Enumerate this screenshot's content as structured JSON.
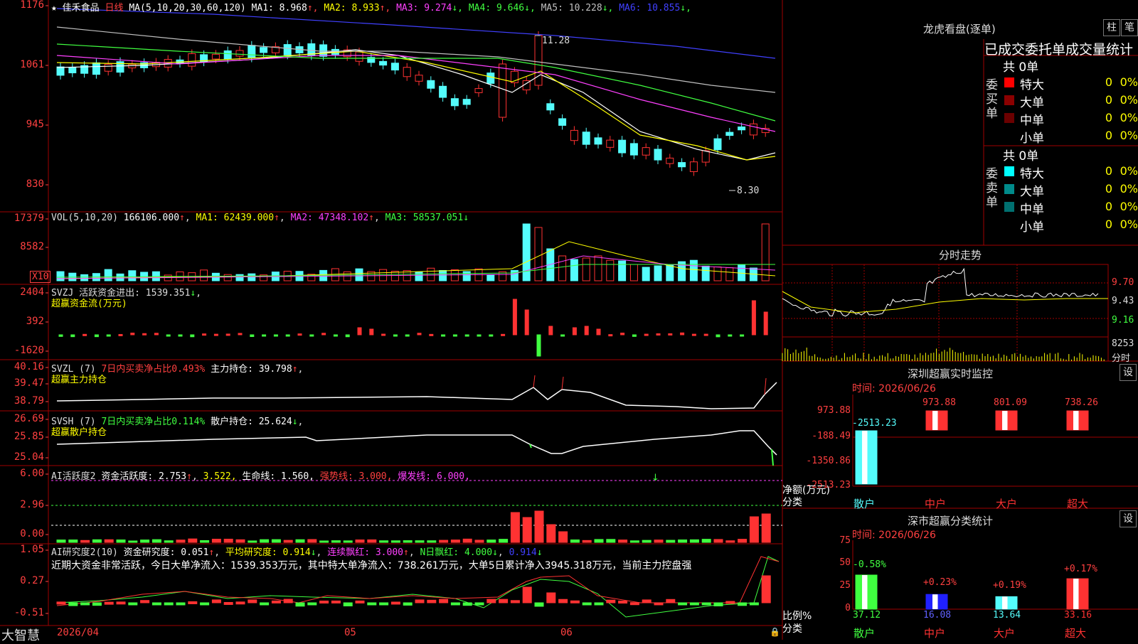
{
  "main_chart": {
    "star": "★",
    "stock_name": "佳禾食品",
    "period": "日线",
    "ma_title": "MA(5,10,20,30,60,120)",
    "ma_values": [
      {
        "label": "MA1: 8.968",
        "arrow": "↑",
        "color": "#ffffff"
      },
      {
        "label": "MA2: 8.933",
        "arrow": "↑",
        "color": "#ffff00"
      },
      {
        "label": "MA3: 9.274",
        "arrow": "↓",
        "color": "#ff40ff"
      },
      {
        "label": "MA4: 9.646",
        "arrow": "↓",
        "color": "#40ff40"
      },
      {
        "label": "MA5: 10.228",
        "arrow": "↓",
        "color": "#c0c0c0"
      },
      {
        "label": "MA6: 10.855",
        "arrow": "↓",
        "color": "#4040ff"
      }
    ],
    "y_ticks": [
      "1176",
      "1061",
      "945",
      "830"
    ],
    "high_label": "11.28",
    "low_label": "8.30"
  },
  "vol_panel": {
    "title": "VOL(5,10,20)",
    "value": "166106.000",
    "ma1": "MA1: 62439.000",
    "ma2": "MA2: 47348.102",
    "ma3": "MA3: 58537.051",
    "y_ticks": [
      "17379",
      "8582"
    ],
    "unit": "X10"
  },
  "svzj_panel": {
    "title": "SVZJ",
    "line1": "活跃资金进出: 1539.351",
    "line2": "超赢资金流(万元)",
    "y_ticks": [
      "2404",
      "392",
      "-1620"
    ]
  },
  "svzl_panel": {
    "title": "SVZL (7)",
    "ratio": "7日内买卖净占比0.493%",
    "holding": "主力持仓: 39.798",
    "line2": "超赢主力持仓",
    "y_ticks": [
      "40.16",
      "39.47",
      "38.79"
    ]
  },
  "svsh_panel": {
    "title": "SVSH (7)",
    "ratio": "7日内买卖净占比0.114%",
    "holding": "散户持仓: 25.624",
    "line2": "超赢散户持仓",
    "y_ticks": [
      "26.69",
      "25.85",
      "25.04"
    ]
  },
  "ai_active_panel": {
    "title": "AI活跃度2",
    "a": "资金活跃度: 2.753",
    "b": "3.522,",
    "c": "生命线: 1.560,",
    "d": "强势线: 3.000,",
    "e": "爆发线: 6.000,",
    "y_ticks": [
      "6.00",
      "2.96",
      "0.00"
    ]
  },
  "ai_research_panel": {
    "title": "AI研究度2(10)",
    "a": "资金研究度: 0.051",
    "b": "平均研究度: 0.914",
    "c": "连续飘红: 3.000",
    "d": "N日飘红: 4.000",
    "e": "0.914",
    "summary": "近期大资金非常活跃，今日大单净流入：1539.353万元，其中特大单净流入：738.261万元，大单5日累计净入3945.318万元，当前主力控盘强",
    "y_ticks": [
      "1.05",
      "0.27",
      "-0.51"
    ]
  },
  "bottom_bar": {
    "brand": "大智慧",
    "date": "2026/04",
    "m5": "05",
    "m6": "06"
  },
  "dragon_tiger": {
    "title": "龙虎看盘(逐单)",
    "btn_a": "柱",
    "btn_b": "笔",
    "col_header": "已成交委托单成交量统计",
    "buy_label": "委买单",
    "sell_label": "委卖单",
    "buy_total": "共 0单",
    "sell_total": "共 0单",
    "buy_rows": [
      {
        "name": "特大",
        "count": "0",
        "pct": "0%",
        "color": "#ff0000"
      },
      {
        "name": "大单",
        "count": "0",
        "pct": "0%",
        "color": "#8b0000"
      },
      {
        "name": "中单",
        "count": "0",
        "pct": "0%",
        "color": "#6b0000"
      },
      {
        "name": "小单",
        "count": "0",
        "pct": "0%",
        "color": "#000000"
      }
    ],
    "sell_rows": [
      {
        "name": "特大",
        "count": "0",
        "pct": "0%",
        "color": "#00ffff"
      },
      {
        "name": "大单",
        "count": "0",
        "pct": "0%",
        "color": "#008b8b"
      },
      {
        "name": "中单",
        "count": "0",
        "pct": "0%",
        "color": "#007070"
      },
      {
        "name": "小单",
        "count": "0",
        "pct": "0%",
        "color": "#000000"
      }
    ]
  },
  "intraday": {
    "title": "分时走势",
    "p_high": "9.70",
    "p_mid": "9.43",
    "p_low": "9.16",
    "vol": "8253",
    "vol_unit": "分时"
  },
  "sz_monitor": {
    "title": "深圳超赢实时监控",
    "setting": "设",
    "time": "时间: 2026/06/26",
    "y_ticks": [
      "973.88",
      "-188.49",
      "-1350.86",
      "-2513.23"
    ],
    "left_value": "-2513.23",
    "bar_values": [
      "973.88",
      "801.09",
      "738.26"
    ],
    "unit_label": "净额(万元)",
    "cat_label": "分类",
    "categories": [
      "散户",
      "中户",
      "大户",
      "超大"
    ],
    "chart_data": {
      "type": "bar",
      "categories": [
        "散户",
        "中户",
        "大户",
        "超大"
      ],
      "values": [
        -2513.23,
        973.88,
        801.09,
        738.26
      ],
      "ylabel": "净额(万元)",
      "xlabel": "分类"
    }
  },
  "sz_stats": {
    "title": "深市超赢分类统计",
    "setting": "设",
    "time": "时间: 2026/06/26",
    "y_ticks": [
      "75",
      "50",
      "25",
      "0"
    ],
    "changes": [
      "-0.58%",
      "+0.23%",
      "+0.19%",
      "+0.17%"
    ],
    "values": [
      "37.12",
      "16.08",
      "13.64",
      "33.16"
    ],
    "unit_label": "比例%",
    "cat_label": "分类",
    "categories": [
      "散户",
      "中户",
      "大户",
      "超大"
    ],
    "chart_data": {
      "type": "bar",
      "categories": [
        "散户",
        "中户",
        "大户",
        "超大"
      ],
      "values": [
        37.12,
        16.08,
        13.64,
        33.16
      ],
      "ylim": [
        0,
        75
      ],
      "ylabel": "比例%",
      "xlabel": "分类"
    }
  },
  "colors": {
    "up": "#ff3232",
    "down": "#54fcfc",
    "border": "#a00000",
    "text": "#dddddd"
  }
}
